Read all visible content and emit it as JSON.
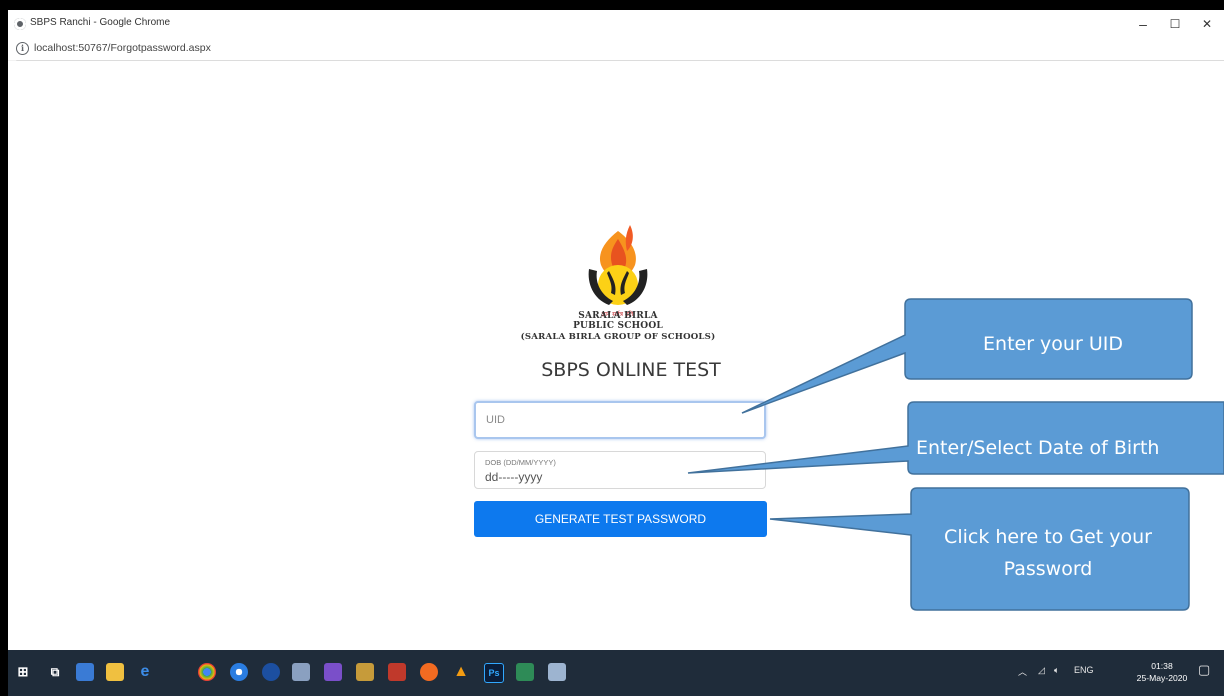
{
  "window": {
    "title": "SBPS Ranchi - Google Chrome",
    "minimize_glyph": "–",
    "maximize_glyph": "☐",
    "close_glyph": "✕"
  },
  "address_bar": {
    "info_glyph": "i",
    "url": "localhost:50767/Forgotpassword.aspx"
  },
  "page": {
    "logo_hindi_text": "ज्ञानं सर्वत्र गतिः",
    "school_line1": "SARALA BIRLA",
    "school_line2": "PUBLIC SCHOOL",
    "school_line3": "(SARALA BIRLA GROUP OF SCHOOLS)",
    "title": "SBPS ONLINE TEST",
    "uid_placeholder": "UID",
    "dob_label": "DOB (DD/MM/YYYY)",
    "dob_value": "dd-----yyyy",
    "generate_button": "GENERATE TEST PASSWORD"
  },
  "callouts": {
    "uid": "Enter your UID",
    "dob": "Enter/Select Date of Birth",
    "password": "Click here to Get your Password",
    "fill_color": "#5b9bd5",
    "border_color": "#41719c"
  },
  "taskbar": {
    "apps": [
      "start-icon",
      "task-view-icon",
      "app-icon",
      "file-explorer-icon",
      "edge-icon",
      "chrome-icon",
      "chrome-icon",
      "app-icon",
      "app-icon",
      "visual-studio-icon",
      "tools-icon",
      "app-icon",
      "app-icon",
      "vlc-icon",
      "photoshop-icon",
      "app-icon",
      "paint-icon"
    ],
    "lang": "ENG",
    "time": "01:38",
    "date": "25-May-2020"
  }
}
